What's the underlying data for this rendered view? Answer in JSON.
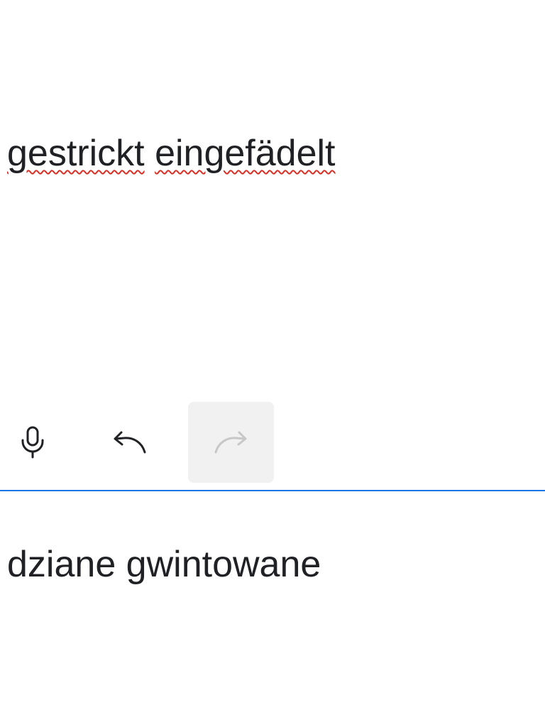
{
  "source": {
    "words": [
      "gestrickt",
      "eingefädelt"
    ],
    "spellcheck_underline_color": "#d93025"
  },
  "toolbar": {
    "mic": {
      "icon": "microphone-icon",
      "enabled": true
    },
    "undo": {
      "icon": "undo-icon",
      "enabled": true
    },
    "redo": {
      "icon": "redo-icon",
      "enabled": false
    }
  },
  "divider_color": "#1a73e8",
  "target": {
    "text": "dziane gwintowane"
  }
}
